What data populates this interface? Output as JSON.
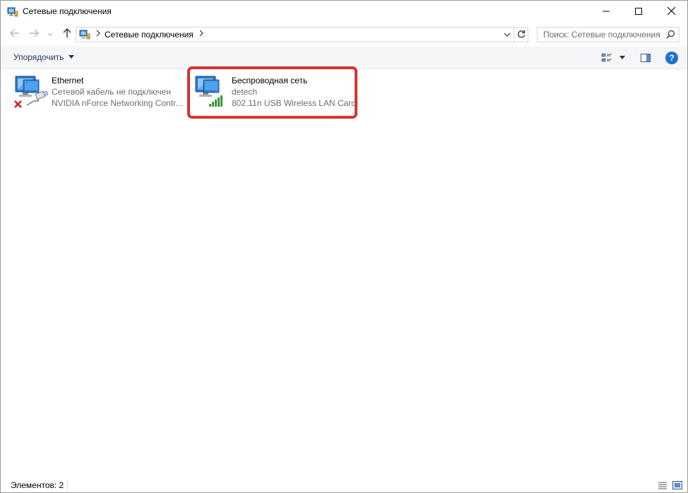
{
  "window": {
    "title": "Сетевые подключения",
    "icon": "network-connections-icon",
    "controls": [
      "minimize-icon",
      "maximize-icon",
      "close-icon"
    ]
  },
  "navigation": {
    "back_icon": "arrow-left-icon",
    "forward_icon": "arrow-right-icon",
    "recent_icon": "chevron-down-icon",
    "up_icon": "arrow-up-icon",
    "address_path": "Сетевые подключения",
    "refresh_icon": "refresh-icon"
  },
  "search": {
    "placeholder": "Поиск: Сетевые подключения"
  },
  "toolbar": {
    "organize_label": "Упорядочить",
    "help_label": "?"
  },
  "connections": [
    {
      "name": "Ethernet",
      "status": "Сетевой кабель не подключен",
      "adapter": "NVIDIA nForce Networking Contr...",
      "state": "disconnected"
    },
    {
      "name": "Беспроводная сеть",
      "status": "detech",
      "adapter": "802.11n USB Wireless LAN Card",
      "state": "connected",
      "highlighted": true
    }
  ],
  "statusbar": {
    "items_count": "Элементов: 2"
  },
  "colors": {
    "highlight_border": "#d9322f",
    "link_text": "#1e395b",
    "secondary_text": "#6d6d6d",
    "signal_green": "#3a9a3a",
    "help_blue": "#1a73d1"
  }
}
